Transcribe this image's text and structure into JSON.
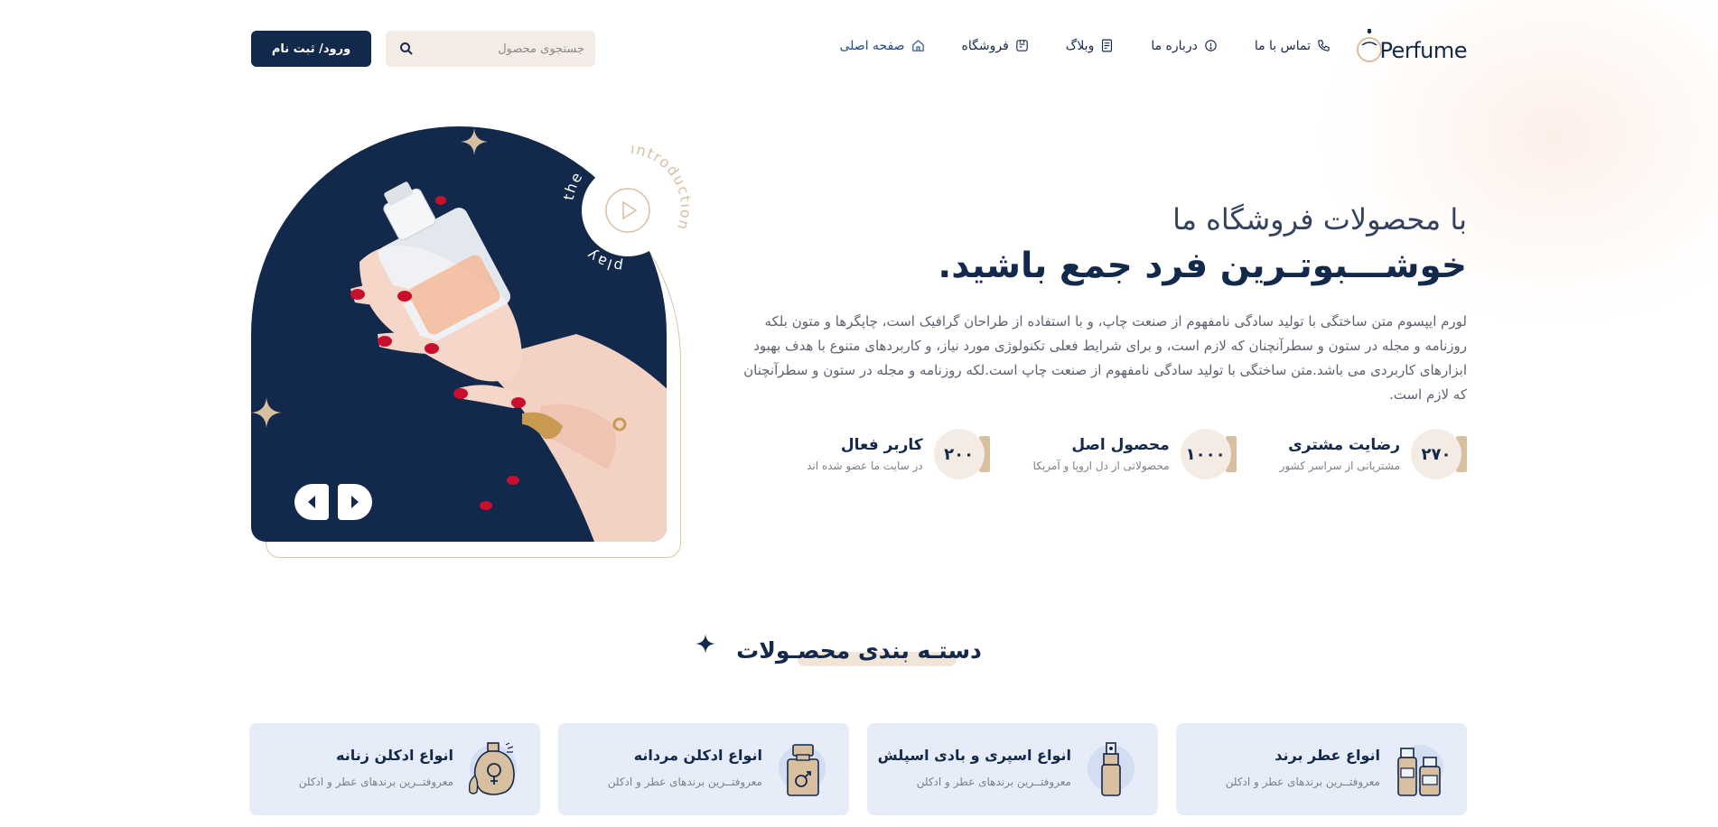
{
  "brand": {
    "name": "Perfume"
  },
  "nav": {
    "items": [
      {
        "label": "صفحه اصلی",
        "icon": "home-icon"
      },
      {
        "label": "فروشگاه",
        "icon": "shop-icon"
      },
      {
        "label": "وبلاگ",
        "icon": "blog-icon"
      },
      {
        "label": "درباره ما",
        "icon": "info-icon"
      },
      {
        "label": "تماس با ما",
        "icon": "phone-icon"
      }
    ]
  },
  "search": {
    "placeholder": "جستجوی محصول",
    "icon": "search-icon"
  },
  "auth": {
    "login_label": "ورود/ ثبت نام"
  },
  "hero": {
    "subtitle": "با محصولات فروشگاه ما",
    "title": "خوشـــبوتـرین فرد جمع باشید.",
    "description": "لورم ایپسوم متن ساختگی با تولید سادگی نامفهوم از صنعت چاپ، و با استفاده از طراحان گرافیک است، چاپگرها و متون بلکه روزنامه و مجله در ستون و سطرآنچنان که لازم است، و برای شرایط فعلی تکنولوژی مورد نیاز، و کاربردهای متنوع با هدف بهبود ابزارهای کاربردی می باشد.متن ساختگی با تولید سادگی نامفهوم از صنعت چاپ است.لکه روزنامه و مجله در ستون و سطرآنچنان که لازم است.",
    "stats": [
      {
        "value": "۲۷۰",
        "title": "رضایت مشتری",
        "subtitle": "مشتریانی از سراسر کشور"
      },
      {
        "value": "۱۰۰۰",
        "title": "محصول اصل",
        "subtitle": "محصولاتی از دل اروپا و آمریکا"
      },
      {
        "value": "۲۰۰",
        "title": "کاربر فعال",
        "subtitle": "در سایت ما عضو شده اند"
      }
    ],
    "video_badge": {
      "top_text": "introduction",
      "side_text": "the",
      "bottom_text": "play"
    }
  },
  "categories": {
    "heading": "دستـه بندی محصـولات",
    "items": [
      {
        "title": "انواع ادکلن زنانه",
        "desc": "معروفتــرین برندهای عطر و ادکلن",
        "icon": "female-perfume-icon"
      },
      {
        "title": "انواع ادکلن مردانه",
        "desc": "معروفتــرین برندهای عطر و ادکلن",
        "icon": "male-perfume-icon"
      },
      {
        "title": "انواع اسپری و بادی اسپلش",
        "desc": "معروفتــرین برندهای عطر و ادکلن",
        "icon": "spray-bottle-icon"
      },
      {
        "title": "انواع عطر برند",
        "desc": "معروفتــرین برندهای عطر و ادکلن",
        "icon": "brand-perfume-icon"
      }
    ]
  },
  "colors": {
    "primary": "#13294b",
    "accent": "#d8bfa0",
    "cream": "#f4ece4",
    "card": "#e6edf9"
  }
}
